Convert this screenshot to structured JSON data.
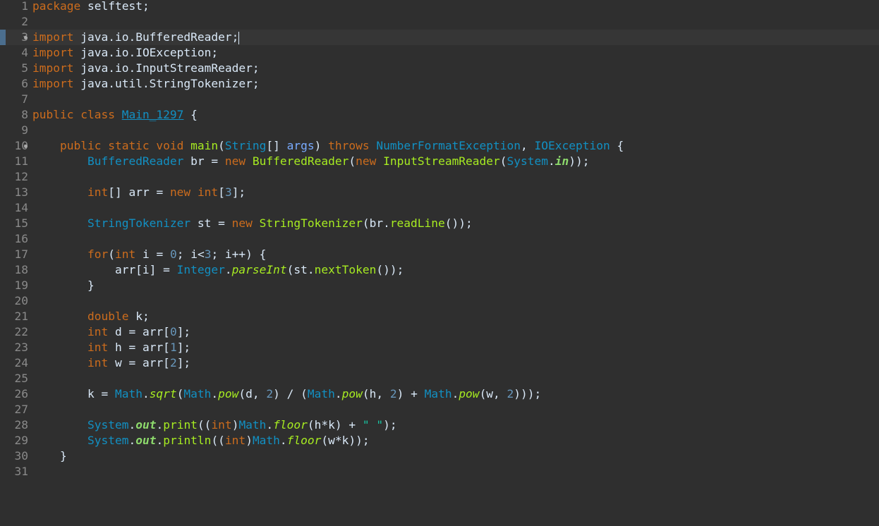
{
  "editor": {
    "lines": [
      {
        "n": "1",
        "t": "package selftest;"
      },
      {
        "n": "2",
        "t": ""
      },
      {
        "n": "3",
        "t": "import java.io.BufferedReader;",
        "current": true
      },
      {
        "n": "4",
        "t": "import java.io.IOException;"
      },
      {
        "n": "5",
        "t": "import java.io.InputStreamReader;"
      },
      {
        "n": "6",
        "t": "import java.util.StringTokenizer;"
      },
      {
        "n": "7",
        "t": ""
      },
      {
        "n": "8",
        "t": "public class Main_1297 {"
      },
      {
        "n": "9",
        "t": ""
      },
      {
        "n": "10",
        "t": "    public static void main(String[] args) throws NumberFormatException, IOException {"
      },
      {
        "n": "11",
        "t": "        BufferedReader br = new BufferedReader(new InputStreamReader(System.in));"
      },
      {
        "n": "12",
        "t": ""
      },
      {
        "n": "13",
        "t": "        int[] arr = new int[3];"
      },
      {
        "n": "14",
        "t": ""
      },
      {
        "n": "15",
        "t": "        StringTokenizer st = new StringTokenizer(br.readLine());"
      },
      {
        "n": "16",
        "t": ""
      },
      {
        "n": "17",
        "t": "        for(int i = 0; i<3; i++) {"
      },
      {
        "n": "18",
        "t": "            arr[i] = Integer.parseInt(st.nextToken());"
      },
      {
        "n": "19",
        "t": "        }"
      },
      {
        "n": "20",
        "t": ""
      },
      {
        "n": "21",
        "t": "        double k;"
      },
      {
        "n": "22",
        "t": "        int d = arr[0];"
      },
      {
        "n": "23",
        "t": "        int h = arr[1];"
      },
      {
        "n": "24",
        "t": "        int w = arr[2];"
      },
      {
        "n": "25",
        "t": ""
      },
      {
        "n": "26",
        "t": "        k = Math.sqrt(Math.pow(d, 2) / (Math.pow(h, 2) + Math.pow(w, 2)));"
      },
      {
        "n": "27",
        "t": ""
      },
      {
        "n": "28",
        "t": "        System.out.print((int)Math.floor(h*k) + \" \");"
      },
      {
        "n": "29",
        "t": "        System.out.println((int)Math.floor(w*k));"
      },
      {
        "n": "30",
        "t": "    }"
      },
      {
        "n": "31",
        "t": ""
      }
    ]
  }
}
